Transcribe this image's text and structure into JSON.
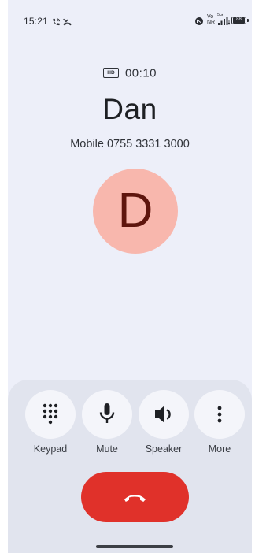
{
  "status_bar": {
    "time": "15:21",
    "left_icons": [
      "phone-call-icon",
      "missed-call-icon"
    ],
    "right_icons": [
      "nfc-icon",
      "volte-icon",
      "signal-icon",
      "battery-icon"
    ],
    "volte_label_top": "Vo",
    "volte_label_bottom": "NR",
    "network_label": "5G",
    "battery_level": "88"
  },
  "call": {
    "hd_label": "HD",
    "timer": "00:10",
    "contact_name": "Dan",
    "number_label": "Mobile 0755 3331 3000",
    "avatar_letter": "D"
  },
  "controls": [
    {
      "label": "Keypad",
      "icon": "keypad-icon"
    },
    {
      "label": "Mute",
      "icon": "microphone-icon"
    },
    {
      "label": "Speaker",
      "icon": "speaker-icon"
    },
    {
      "label": "More",
      "icon": "more-vertical-icon"
    }
  ],
  "end_call": {
    "icon": "end-call-icon"
  },
  "colors": {
    "background": "#edeff9",
    "panel": "#e1e4ee",
    "avatar_bg": "#f8b7ad",
    "avatar_text": "#5e150d",
    "end_call": "#e0312a"
  }
}
